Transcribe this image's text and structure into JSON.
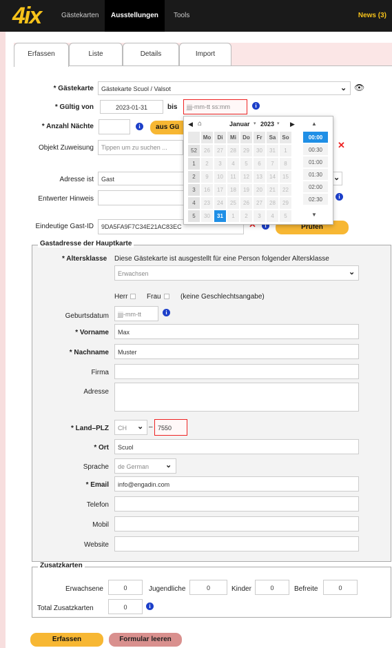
{
  "app": {
    "logo": "4ix",
    "news": "News (3)",
    "nav": [
      "Gästekarten",
      "Ausstellungen",
      "Tools"
    ]
  },
  "tabs": [
    "Erfassen",
    "Liste",
    "Details",
    "Import"
  ],
  "form": {
    "gaestekarte": {
      "label": "* Gästekarte",
      "value": "Gästekarte Scuol / Valsot"
    },
    "gueltig": {
      "label": "* Gültig von",
      "from": "2023-01-31",
      "bis": "bis",
      "to_placeholder": "jjjj-mm-tt ss:mm"
    },
    "naechte": {
      "label": "* Anzahl Nächte",
      "button": "aus Gü"
    },
    "objekt": {
      "label": "Objekt Zuweisung",
      "placeholder": "Tippen um zu suchen ..."
    },
    "adresse_ist": {
      "label": "Adresse ist",
      "value": "Gast"
    },
    "entwerter": {
      "label": "Entwerter Hinweis"
    },
    "gast_id": {
      "label": "Eindeutige Gast-ID",
      "value": "9DA5FA9F7C34E21AC83EC",
      "button": "Prüfen"
    }
  },
  "calendar": {
    "month": "Januar",
    "year": "2023",
    "headers": [
      "Mo",
      "Di",
      "Mi",
      "Do",
      "Fr",
      "Sa",
      "So"
    ],
    "weeks": [
      {
        "wk": "52",
        "days": [
          "26",
          "27",
          "28",
          "29",
          "30",
          "31",
          "1"
        ]
      },
      {
        "wk": "1",
        "days": [
          "2",
          "3",
          "4",
          "5",
          "6",
          "7",
          "8"
        ]
      },
      {
        "wk": "2",
        "days": [
          "9",
          "10",
          "11",
          "12",
          "13",
          "14",
          "15"
        ]
      },
      {
        "wk": "3",
        "days": [
          "16",
          "17",
          "18",
          "19",
          "20",
          "21",
          "22"
        ]
      },
      {
        "wk": "4",
        "days": [
          "23",
          "24",
          "25",
          "26",
          "27",
          "28",
          "29"
        ]
      },
      {
        "wk": "5",
        "days": [
          "30",
          "31",
          "1",
          "2",
          "3",
          "4",
          "5"
        ]
      }
    ],
    "times": [
      "00:00",
      "00:30",
      "01:00",
      "01:30",
      "02:00",
      "02:30"
    ]
  },
  "guest": {
    "legend": "Gastadresse der Hauptkarte",
    "altersklasse": {
      "label": "* Altersklasse",
      "text": "Diese Gästekarte ist ausgestellt für eine Person folgender Altersklasse",
      "value": "Erwachsen"
    },
    "gender": {
      "herr": "Herr",
      "frau": "Frau",
      "none": "(keine Geschlechtsangabe)"
    },
    "geburtsdatum": {
      "label": "Geburtsdatum",
      "placeholder": "jjjj-mm-tt"
    },
    "vorname": {
      "label": "* Vorname",
      "value": "Max"
    },
    "nachname": {
      "label": "* Nachname",
      "value": "Muster"
    },
    "firma": {
      "label": "Firma"
    },
    "adresse": {
      "label": "Adresse"
    },
    "land_plz": {
      "label": "* Land–PLZ",
      "country": "CH",
      "dash": "–",
      "plz": "7550"
    },
    "ort": {
      "label": "* Ort",
      "value": "Scuol"
    },
    "sprache": {
      "label": "Sprache",
      "value": "de German"
    },
    "email": {
      "label": "* Email",
      "value": "info@engadin.com"
    },
    "telefon": {
      "label": "Telefon"
    },
    "mobil": {
      "label": "Mobil"
    },
    "website": {
      "label": "Website"
    }
  },
  "extra": {
    "legend": "Zusatzkarten",
    "erwachsene": {
      "label": "Erwachsene",
      "value": "0"
    },
    "jugendliche": {
      "label": "Jugendliche",
      "value": "0"
    },
    "kinder": {
      "label": "Kinder",
      "value": "0"
    },
    "befreite": {
      "label": "Befreite",
      "value": "0"
    },
    "total": {
      "label": "Total Zusatzkarten",
      "value": "0"
    }
  },
  "actions": {
    "submit": "Erfassen",
    "reset": "Formular leeren"
  }
}
